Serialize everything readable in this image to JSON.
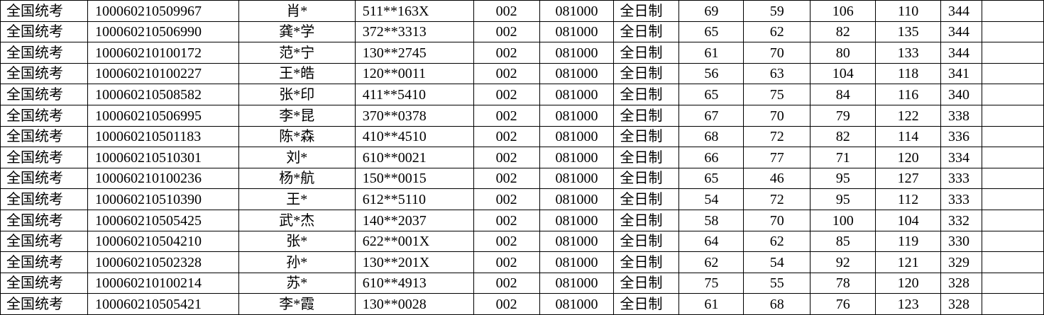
{
  "columns": [
    "exam_type",
    "candidate_no",
    "name",
    "id_masked",
    "direction",
    "major_code",
    "study_mode",
    "politics",
    "english",
    "subject1",
    "subject2",
    "total",
    "extra"
  ],
  "rows": [
    [
      "全国统考",
      "100060210509967",
      "肖*",
      "511**163X",
      "002",
      "081000",
      "全日制",
      "69",
      "59",
      "106",
      "110",
      "344",
      ""
    ],
    [
      "全国统考",
      "100060210506990",
      "龚*学",
      "372**3313",
      "002",
      "081000",
      "全日制",
      "65",
      "62",
      "82",
      "135",
      "344",
      ""
    ],
    [
      "全国统考",
      "100060210100172",
      "范*宁",
      "130**2745",
      "002",
      "081000",
      "全日制",
      "61",
      "70",
      "80",
      "133",
      "344",
      ""
    ],
    [
      "全国统考",
      "100060210100227",
      "王*皓",
      "120**0011",
      "002",
      "081000",
      "全日制",
      "56",
      "63",
      "104",
      "118",
      "341",
      ""
    ],
    [
      "全国统考",
      "100060210508582",
      "张*印",
      "411**5410",
      "002",
      "081000",
      "全日制",
      "65",
      "75",
      "84",
      "116",
      "340",
      ""
    ],
    [
      "全国统考",
      "100060210506995",
      "李*昆",
      "370**0378",
      "002",
      "081000",
      "全日制",
      "67",
      "70",
      "79",
      "122",
      "338",
      ""
    ],
    [
      "全国统考",
      "100060210501183",
      "陈*森",
      "410**4510",
      "002",
      "081000",
      "全日制",
      "68",
      "72",
      "82",
      "114",
      "336",
      ""
    ],
    [
      "全国统考",
      "100060210510301",
      "刘*",
      "610**0021",
      "002",
      "081000",
      "全日制",
      "66",
      "77",
      "71",
      "120",
      "334",
      ""
    ],
    [
      "全国统考",
      "100060210100236",
      "杨*航",
      "150**0015",
      "002",
      "081000",
      "全日制",
      "65",
      "46",
      "95",
      "127",
      "333",
      ""
    ],
    [
      "全国统考",
      "100060210510390",
      "王*",
      "612**5110",
      "002",
      "081000",
      "全日制",
      "54",
      "72",
      "95",
      "112",
      "333",
      ""
    ],
    [
      "全国统考",
      "100060210505425",
      "武*杰",
      "140**2037",
      "002",
      "081000",
      "全日制",
      "58",
      "70",
      "100",
      "104",
      "332",
      ""
    ],
    [
      "全国统考",
      "100060210504210",
      "张*",
      "622**001X",
      "002",
      "081000",
      "全日制",
      "64",
      "62",
      "85",
      "119",
      "330",
      ""
    ],
    [
      "全国统考",
      "100060210502328",
      "孙*",
      "130**201X",
      "002",
      "081000",
      "全日制",
      "62",
      "54",
      "92",
      "121",
      "329",
      ""
    ],
    [
      "全国统考",
      "100060210100214",
      "苏*",
      "610**4913",
      "002",
      "081000",
      "全日制",
      "75",
      "55",
      "78",
      "120",
      "328",
      ""
    ],
    [
      "全国统考",
      "100060210505421",
      "李*霞",
      "130**0028",
      "002",
      "081000",
      "全日制",
      "61",
      "68",
      "76",
      "123",
      "328",
      ""
    ]
  ]
}
